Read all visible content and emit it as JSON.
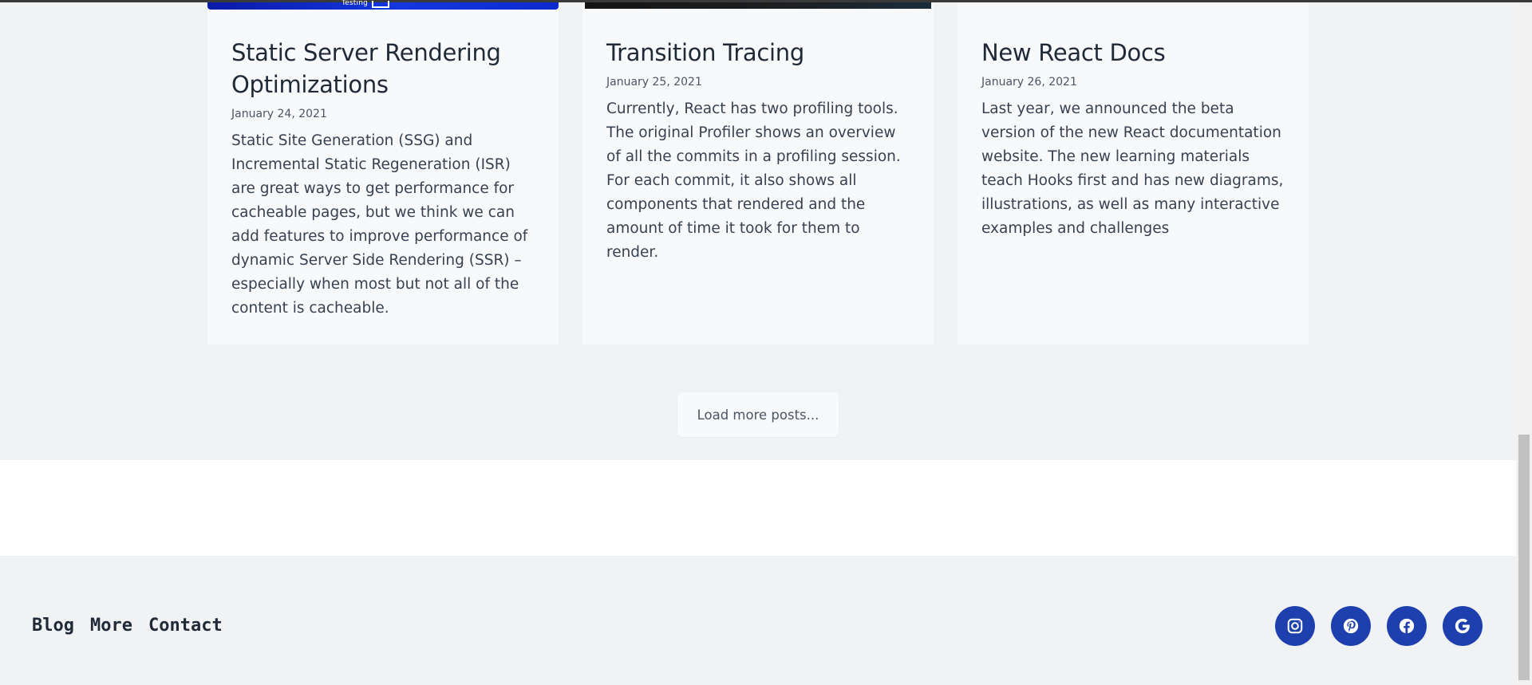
{
  "posts": [
    {
      "title": "Static Server Rendering Optimizations",
      "date": "January 24, 2021",
      "excerpt": "Static Site Generation (SSG) and Incremental Static Regeneration (ISR) are great ways to get performance for cacheable pages, but we think we can add features to improve performance of dynamic Server Side Rendering (SSR) – especially when most but not all of the content is cacheable.",
      "image_caption": "Testing"
    },
    {
      "title": "Transition Tracing",
      "date": "January 25, 2021",
      "excerpt": "Currently, React has two profiling tools. The original Profiler shows an overview of all the commits in a profiling session. For each commit, it also shows all components that rendered and the amount of time it took for them to render."
    },
    {
      "title": "New React Docs",
      "date": "January 26, 2021",
      "excerpt": "Last year, we announced the beta version of the new React documentation website. The new learning materials teach Hooks first and has new diagrams, illustrations, as well as many interactive examples and challenges"
    }
  ],
  "load_more_label": "Load more posts...",
  "footer": {
    "nav": [
      "Blog",
      "More",
      "Contact"
    ],
    "social_icons": [
      "instagram-icon",
      "pinterest-icon",
      "facebook-icon",
      "google-icon"
    ]
  },
  "colors": {
    "accent": "#1e40af",
    "page_bg": "#f1f2f4",
    "card_bg": "#f8f9fb"
  }
}
